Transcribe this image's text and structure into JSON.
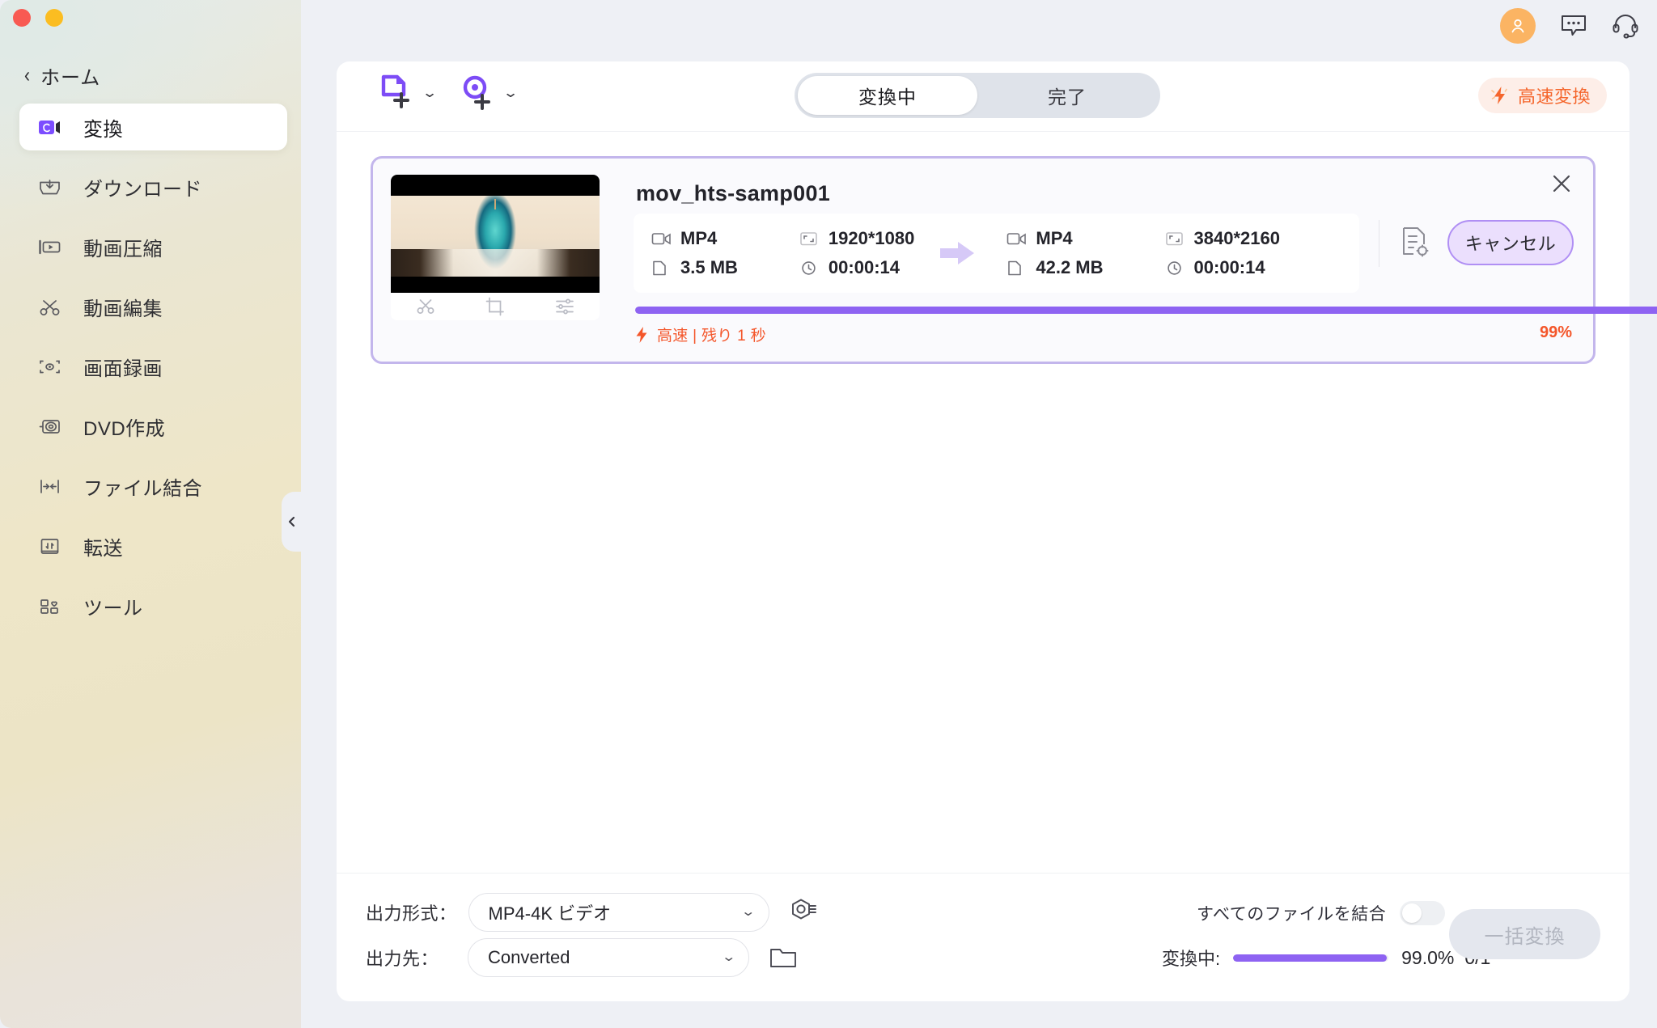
{
  "window": {
    "traffic_lights": [
      "close",
      "minimize"
    ]
  },
  "sidebar": {
    "home_label": "ホーム",
    "back_icon": "chevron-left-icon",
    "collapse_icon": "chevron-left-icon",
    "items": [
      {
        "label": "変換",
        "icon": "convert-video-icon",
        "active": true
      },
      {
        "label": "ダウンロード",
        "icon": "download-tray-icon",
        "active": false
      },
      {
        "label": "動画圧縮",
        "icon": "video-compress-icon",
        "active": false
      },
      {
        "label": "動画編集",
        "icon": "scissors-icon",
        "active": false
      },
      {
        "label": "画面録画",
        "icon": "screen-record-icon",
        "active": false
      },
      {
        "label": "DVD作成",
        "icon": "dvd-disc-icon",
        "active": false
      },
      {
        "label": "ファイル結合",
        "icon": "merge-files-icon",
        "active": false
      },
      {
        "label": "転送",
        "icon": "transfer-icon",
        "active": false
      },
      {
        "label": "ツール",
        "icon": "toolbox-grid-icon",
        "active": false
      }
    ]
  },
  "topbar": {
    "avatar_icon": "user-avatar-icon",
    "feedback_icon": "chat-bubble-icon",
    "support_icon": "headset-icon"
  },
  "toolbar": {
    "add_file_icon": "add-file-icon",
    "add_file_caret": "⌄",
    "add_disc_icon": "add-disc-icon",
    "add_disc_caret": "⌄",
    "tabs": [
      {
        "label": "変換中",
        "active": true
      },
      {
        "label": "完了",
        "active": false
      }
    ],
    "high_speed": {
      "label": "高速変換",
      "icon": "lightning-bolt-icon"
    }
  },
  "file_card": {
    "name": "mov_hts-samp001",
    "thumbnail_alt": "chapel-interior-thumbnail",
    "thumb_tools": [
      {
        "icon": "scissors-trim-icon",
        "name": "trim"
      },
      {
        "icon": "crop-icon",
        "name": "crop"
      },
      {
        "icon": "effects-sliders-icon",
        "name": "effects"
      }
    ],
    "source": {
      "format": "MP4",
      "resolution": "1920*1080",
      "size": "3.5 MB",
      "duration": "00:00:14"
    },
    "target": {
      "format": "MP4",
      "resolution": "3840*2160",
      "size": "42.2 MB",
      "duration": "00:00:14"
    },
    "arrow_icon": "arrow-right-icon",
    "settings_icon": "file-settings-icon",
    "cancel_label": "キャンセル",
    "close_icon": "close-x-icon",
    "progress": {
      "percent_text": "99%",
      "percent_value": 99,
      "status_icon": "lightning-bolt-icon",
      "status_text": "高速 | 残り 1 秒"
    }
  },
  "bottom": {
    "format_label": "出力形式：",
    "format_value": "MP4-4K ビデオ",
    "format_caret": "⌄",
    "format_settings_icon": "format-settings-icon",
    "dest_label": "出力先：",
    "dest_value": "Converted",
    "dest_caret": "⌄",
    "dest_folder_icon": "folder-icon",
    "merge_label": "すべてのファイルを結合",
    "merge_toggle_on": false,
    "converting_label": "変換中:",
    "converting_percent_text": "99.0%",
    "converting_percent_value": 99,
    "converting_count": "0/1",
    "batch_convert_label": "一括変換"
  },
  "colors": {
    "accent_purple": "#8e63f2",
    "accent_orange": "#f4562a",
    "card_border": "#c3b6ec",
    "avatar_bg": "#fbb463"
  }
}
